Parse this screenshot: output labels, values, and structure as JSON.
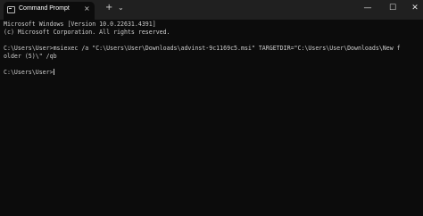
{
  "tab": {
    "title": "Command Prompt",
    "close_icon": "×",
    "icon": "terminal-icon"
  },
  "tabbar": {
    "new_tab": "+",
    "dropdown": "⌄"
  },
  "window_controls": {
    "minimize": "—",
    "maximize": "☐",
    "close": "✕"
  },
  "console": {
    "lines": [
      "Microsoft Windows [Version 10.0.22631.4391]",
      "(c) Microsoft Corporation. All rights reserved.",
      "",
      "C:\\Users\\User>msiexec /a \"C:\\Users\\User\\Downloads\\advinst-9c1169c5.msi\" TARGETDIR=\"C:\\Users\\User\\Downloads\\New f",
      "older (5)\\\" /qb",
      "",
      "C:\\Users\\User>"
    ]
  },
  "colors": {
    "background": "#0c0c0c",
    "titlebar": "#202020",
    "text": "#cccccc"
  }
}
